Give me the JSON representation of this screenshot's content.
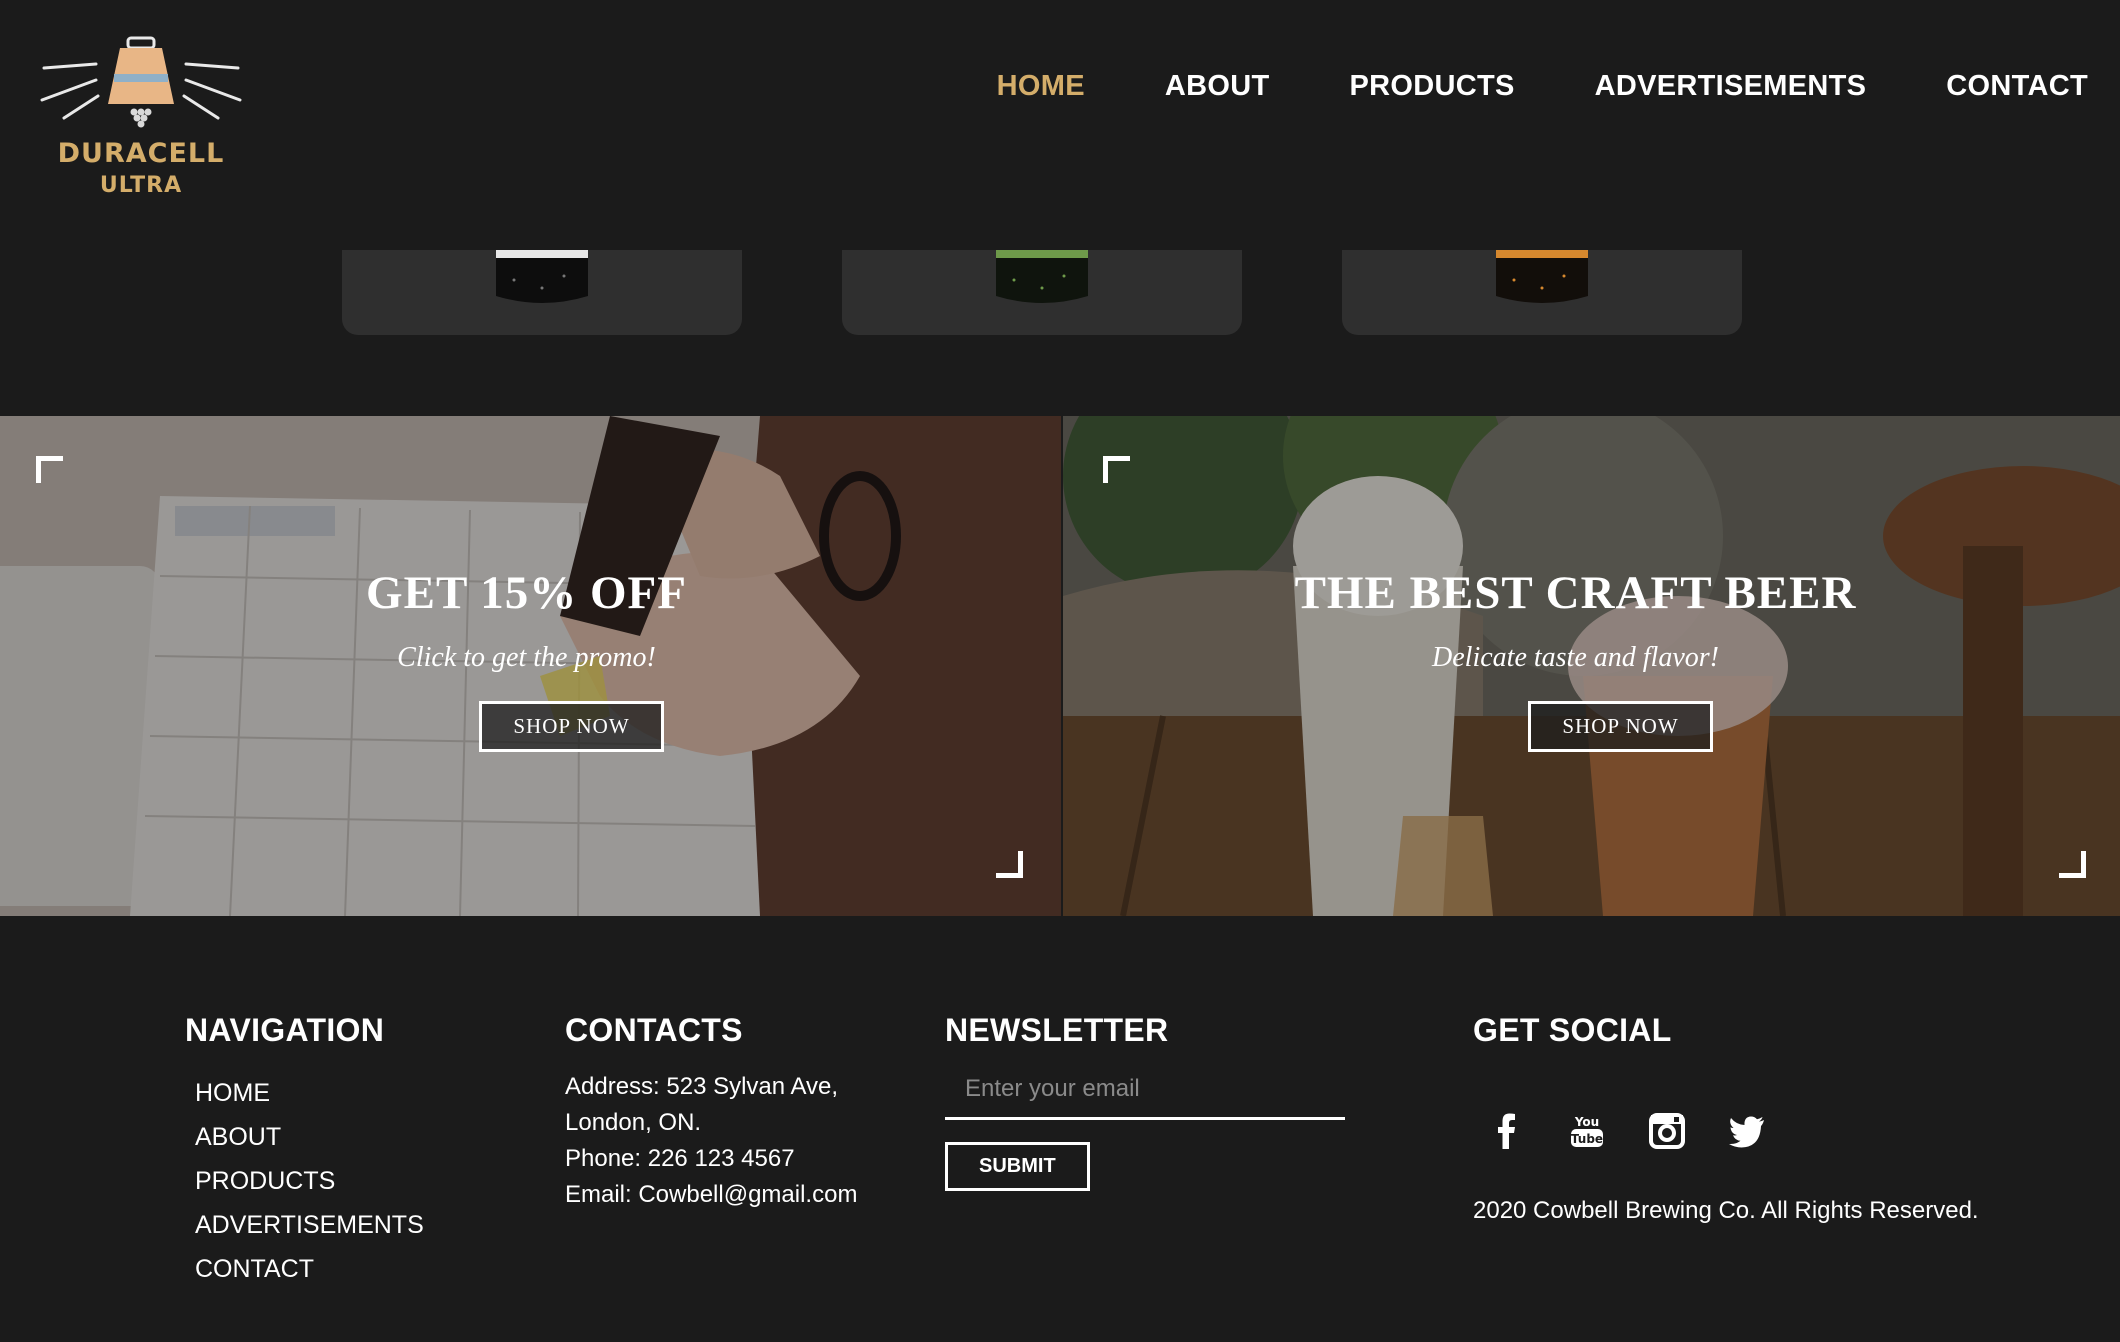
{
  "brand": {
    "name": "DURACELL",
    "sub": "ULTRA",
    "accent": "#d4ad6a"
  },
  "nav": {
    "items": [
      {
        "label": "HOME",
        "active": true
      },
      {
        "label": "ABOUT"
      },
      {
        "label": "PRODUCTS"
      },
      {
        "label": "ADVERTISEMENTS"
      },
      {
        "label": "CONTACT"
      }
    ]
  },
  "products": [
    {
      "icon": "beer-can-icon",
      "band": "#e8e8e8"
    },
    {
      "icon": "beer-can-icon",
      "band": "#6e9a4a"
    },
    {
      "icon": "beer-can-icon",
      "band": "#d6882e"
    }
  ],
  "promos": [
    {
      "title": "GET 15% OFF",
      "subtitle": "Click to get the promo!",
      "button": "SHOP NOW"
    },
    {
      "title": "THE BEST CRAFT BEER",
      "subtitle": "Delicate taste and flavor!",
      "button": "SHOP NOW"
    }
  ],
  "footer": {
    "navigation": {
      "title": "NAVIGATION",
      "items": [
        "HOME",
        "ABOUT",
        "PRODUCTS",
        "ADVERTISEMENTS",
        "CONTACT"
      ]
    },
    "contacts": {
      "title": "CONTACTS",
      "lines": [
        "Address: 523 Sylvan Ave,",
        "London, ON.",
        "Phone: 226 123 4567",
        "Email: Cowbell@gmail.com"
      ]
    },
    "newsletter": {
      "title": "NEWSLETTER",
      "placeholder": "Enter your email",
      "submit": "SUBMIT"
    },
    "social": {
      "title": "GET SOCIAL",
      "icons": [
        "facebook-icon",
        "youtube-icon",
        "instagram-icon",
        "twitter-icon"
      ],
      "copyright": "2020 Cowbell Brewing Co. All Rights Reserved."
    }
  }
}
